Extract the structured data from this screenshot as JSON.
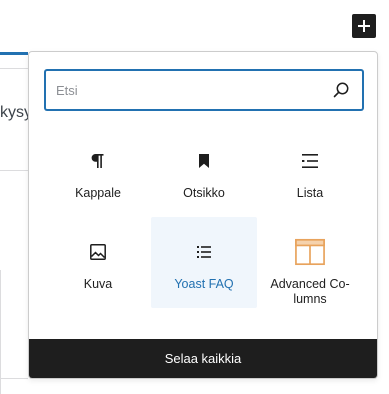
{
  "background": {
    "partial_text": "kysy"
  },
  "toolbar": {
    "toggle_icon": "plus-icon"
  },
  "inserter": {
    "search": {
      "placeholder": "Etsi",
      "value": "",
      "icon": "search-icon"
    },
    "blocks": [
      {
        "label": "Kappale",
        "icon": "paragraph-icon",
        "selected": false
      },
      {
        "label": "Otsikko",
        "icon": "bookmark-icon",
        "selected": false
      },
      {
        "label": "Lista",
        "icon": "list-icon",
        "selected": false
      },
      {
        "label": "Kuva",
        "icon": "image-icon",
        "selected": false
      },
      {
        "label": "Yoast FAQ",
        "icon": "faq-list-icon",
        "selected": true
      },
      {
        "label": "Advanced Co-lumns",
        "icon": "columns-layout-icon",
        "selected": false
      }
    ],
    "footer_label": "Selaa kaikkia"
  },
  "colors": {
    "accent": "#2271b1",
    "dark": "#1e1e1e",
    "columns_icon": "#e8a35c",
    "selected_bg": "#f0f6fc"
  }
}
